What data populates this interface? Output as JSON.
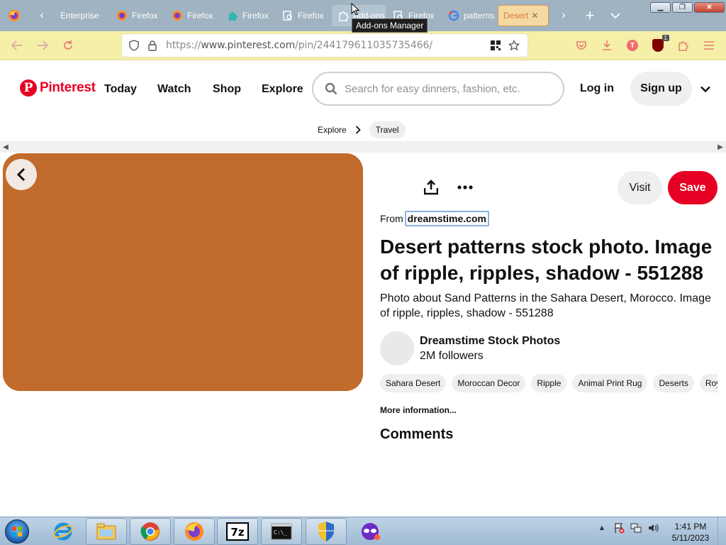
{
  "browser": {
    "tabs": [
      {
        "label": "Enterprise",
        "icon": "firefox-icon"
      },
      {
        "label": "Firefox",
        "icon": "firefox-icon"
      },
      {
        "label": "Firefox",
        "icon": "firefox-icon"
      },
      {
        "label": "Firefox",
        "icon": "puzzle-teal-icon"
      },
      {
        "label": "Firefox",
        "icon": "search-doc-icon"
      },
      {
        "label": "Add-ons",
        "icon": "puzzle-icon"
      },
      {
        "label": "Firefox",
        "icon": "search-doc-icon"
      },
      {
        "label": "patterns",
        "icon": "google-icon"
      },
      {
        "label": "Desert",
        "icon": "pinterest-icon"
      }
    ],
    "tooltip": "Add-ons Manager",
    "url": {
      "scheme": "https://",
      "host": "www.pinterest.com",
      "path": "/pin/244179611035735466/"
    },
    "extension_badge": "1",
    "profile_initial": "T"
  },
  "pinterest": {
    "logo_text": "Pinterest",
    "nav": {
      "today": "Today",
      "watch": "Watch",
      "shop": "Shop",
      "explore": "Explore"
    },
    "search_placeholder": "Search for easy dinners, fashion, etc.",
    "login": "Log in",
    "signup": "Sign up",
    "breadcrumb": {
      "root": "Explore",
      "current": "Travel"
    },
    "pin": {
      "image_color": "#c16b2c",
      "visit": "Visit",
      "save": "Save",
      "from_label": "From",
      "from_source": "dreamstime.com",
      "title": "Desert patterns stock photo. Image of ripple, ripples, shadow - 551288",
      "description": "Photo about Sand Patterns in the Sahara Desert, Morocco. Image of ripple, ripples, shadow - 551288",
      "creator_name": "Dreamstime Stock Photos",
      "creator_followers": "2M followers",
      "tags": [
        "Sahara Desert",
        "Moroccan Decor",
        "Ripple",
        "Animal Print Rug",
        "Deserts",
        "Royalty Free"
      ],
      "more_info": "More information...",
      "comments": "Comments"
    }
  },
  "taskbar": {
    "time": "1:41 PM",
    "date": "5/11/2023",
    "apps": [
      "internet-explorer-icon",
      "file-explorer-icon",
      "chrome-icon",
      "firefox-icon",
      "7zip-icon",
      "cmd-icon",
      "security-shield-icon",
      "mask-app-icon"
    ]
  },
  "colors": {
    "pinterest_red": "#e60023",
    "tabstrip": "#9fb3c2",
    "toolbar": "#f5efa8"
  }
}
